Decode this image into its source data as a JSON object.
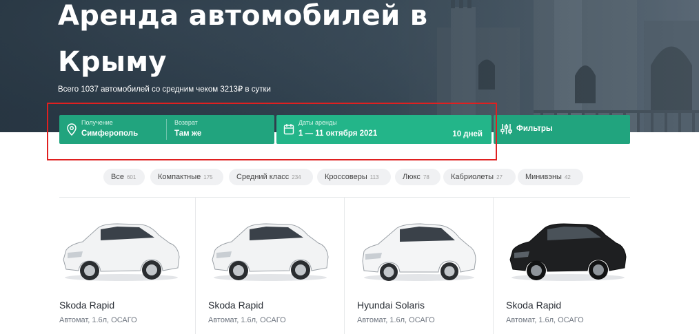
{
  "hero": {
    "title_line1": "Аренда автомобилей в",
    "title_line2": "Крыму",
    "subtitle": "Всего 1037 автомобилей со средним чеком 3213₽ в сутки"
  },
  "search": {
    "pickup_label": "Получение",
    "pickup_value": "Симферополь",
    "return_label": "Возврат",
    "return_value": "Там же",
    "dates_label": "Даты аренды",
    "dates_value": "1 — 11 октября 2021",
    "days": "10 дней",
    "filters_label": "Фильтры"
  },
  "categories": [
    {
      "label": "Все",
      "count": "601"
    },
    {
      "label": "Компактные",
      "count": "175"
    },
    {
      "label": "Средний класс",
      "count": "234"
    },
    {
      "label": "Кроссоверы",
      "count": "113"
    },
    {
      "label": "Люкс",
      "count": "78"
    },
    {
      "label": "Кабриолеты",
      "count": "27"
    },
    {
      "label": "Минивэны",
      "count": "42"
    }
  ],
  "cars": [
    {
      "name": "Skoda Rapid",
      "spec": "Автомат, 1.6л, ОСАГО",
      "color": "#f2f3f4"
    },
    {
      "name": "Skoda Rapid",
      "spec": "Автомат, 1.6л, ОСАГО",
      "color": "#f2f3f4"
    },
    {
      "name": "Hyundai Solaris",
      "spec": "Автомат, 1.6л, ОСАГО",
      "color": "#f4f5f6"
    },
    {
      "name": "Skoda Rapid",
      "spec": "Автомат, 1.6л, ОСАГО",
      "color": "#1e1f21"
    }
  ],
  "colors": {
    "accent": "#21a47e",
    "accent_light": "#23b589",
    "highlight": "#e02020"
  }
}
